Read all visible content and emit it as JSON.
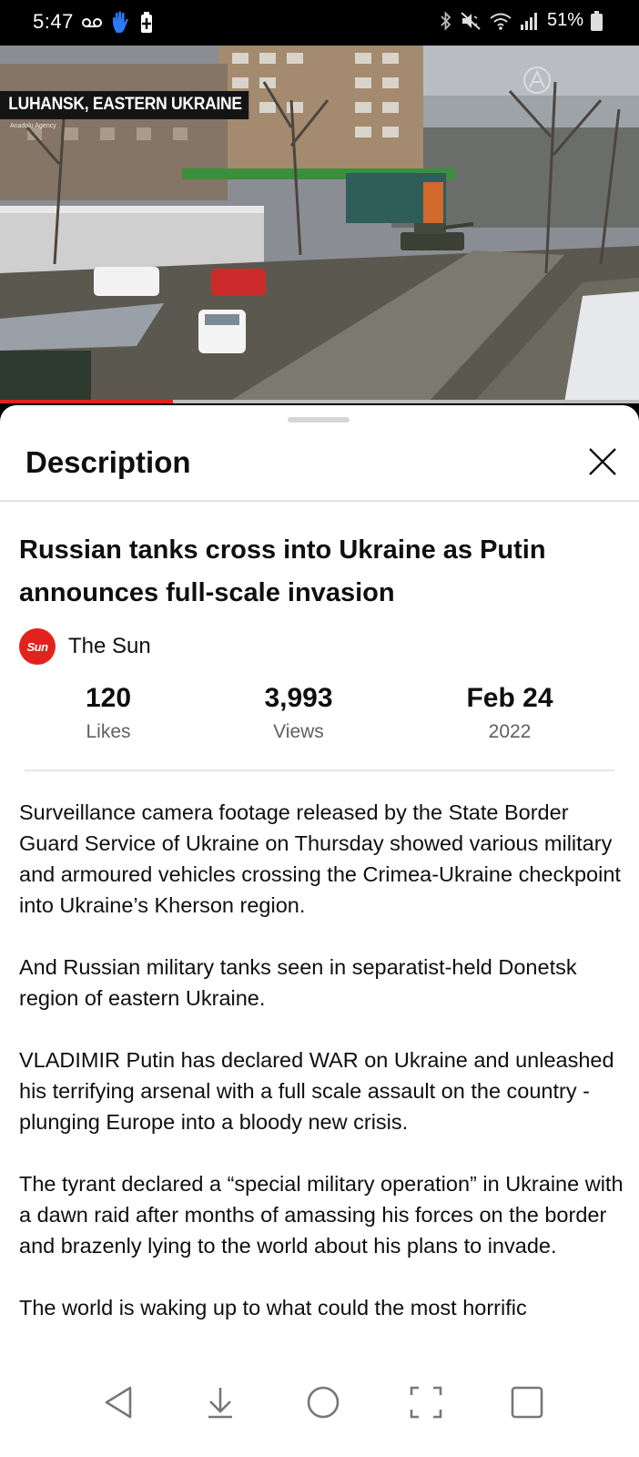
{
  "status_bar": {
    "time": "5:47",
    "battery": "51%",
    "icons": [
      "voicemail-icon",
      "hand-icon",
      "battery-saver-icon",
      "bluetooth-icon",
      "mute-icon",
      "wifi-icon",
      "signal-icon",
      "battery-icon"
    ]
  },
  "video": {
    "caption": "LUHANSK, EASTERN UKRAINE",
    "credit": "Anadolu Agency",
    "progress": 0.27
  },
  "sheet": {
    "title": "Description",
    "video_title": "Russian tanks cross into Ukraine as Putin announces full-scale invasion",
    "channel": {
      "logo_text": "Sun",
      "name": "The Sun"
    },
    "stats": [
      {
        "value": "120",
        "label": "Likes"
      },
      {
        "value": "3,993",
        "label": "Views"
      },
      {
        "value": "Feb 24",
        "label": "2022"
      }
    ],
    "paragraphs": [
      "Surveillance camera footage released by the State Border Guard Service of Ukraine on Thursday showed various military and armoured vehicles crossing the Crimea-Ukraine checkpoint into Ukraine’s Kherson region.",
      "And Russian military tanks seen in separatist-held Donetsk region of eastern Ukraine.",
      "VLADIMIR Putin has declared WAR on Ukraine and unleashed his terrifying arsenal with a full scale assault on the country - plunging Europe into a bloody new crisis.",
      "The tyrant declared a “special military operation” in Ukraine with a dawn raid after months of amassing his forces on the border and brazenly lying to the world about his plans to invade.",
      "The world is waking up to what could the most horrific"
    ]
  },
  "colors": {
    "accent_red": "#e5201c",
    "sun_logo_red": "#e2221c",
    "text_primary": "#0f0f0f",
    "text_secondary": "#606060"
  },
  "nav_bar": {
    "icons": [
      "back-icon",
      "download-icon",
      "home-icon",
      "screenshot-icon",
      "recents-icon"
    ]
  }
}
